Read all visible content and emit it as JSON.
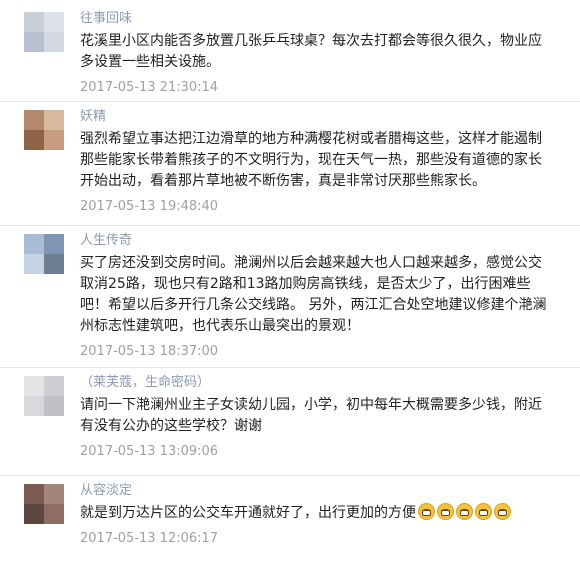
{
  "comments": [
    {
      "name": "往事回味",
      "text": "花溪里小区内能否多放置几张乒乓球桌？每次去打都会等很久很久，物业应多设置一些相关设施。",
      "time": "2017-05-13 21:30:14",
      "avatar_colors": [
        "#c9cedb",
        "#dde1ea",
        "#b8bfcf",
        "#d3d8e3"
      ]
    },
    {
      "name": "妖精",
      "text": "强烈希望立事达把江边滑草的地方种满樱花树或者腊梅这些，这样才能遏制那些能家长带着熊孩子的不文明行为，现在天气一热，那些没有道德的家长开始出动，看着那片草地被不断伤害，真是非常讨厌那些熊家长。",
      "time": "2017-05-13 19:48:40",
      "avatar_colors": [
        "#b2896a",
        "#d8b9a0",
        "#8c6547",
        "#c79c7e"
      ]
    },
    {
      "name": "人生传奇",
      "text": "买了房还没到交房时间。滟澜州以后会越来越大也人口越来越多，感觉公交取消25路，现也只有2路和13路加购房高铁线，是否太少了，出行困难些吧！希望以后多开行几条公交线路。 另外，两江汇合处空地建议修建个滟澜州标志性建筑吧，也代表乐山最突出的景观！",
      "time": "2017-05-13 18:37:00",
      "avatar_colors": [
        "#a8bcd6",
        "#7e95b3",
        "#c4d2e4",
        "#6d7f94"
      ]
    },
    {
      "name": "（莱芙蔻，生命密码）",
      "text": "请问一下滟澜州业主子女读幼儿园，小学，初中每年大概需要多少钱，附近有没有公办的这些学校？谢谢",
      "time": "2017-05-13 13:09:06",
      "avatar_colors": [
        "#e4e4e6",
        "#cfcfd3",
        "#d9d9dc",
        "#c0c0c6"
      ]
    },
    {
      "name": "从容淡定",
      "text": "就是到万达片区的公交车开通就好了，出行更加的方便",
      "emoji_count": 5,
      "time": "2017-05-13 12:06:17",
      "avatar_colors": [
        "#7a5a52",
        "#a3857c",
        "#5c4640",
        "#8f6d63"
      ]
    }
  ]
}
